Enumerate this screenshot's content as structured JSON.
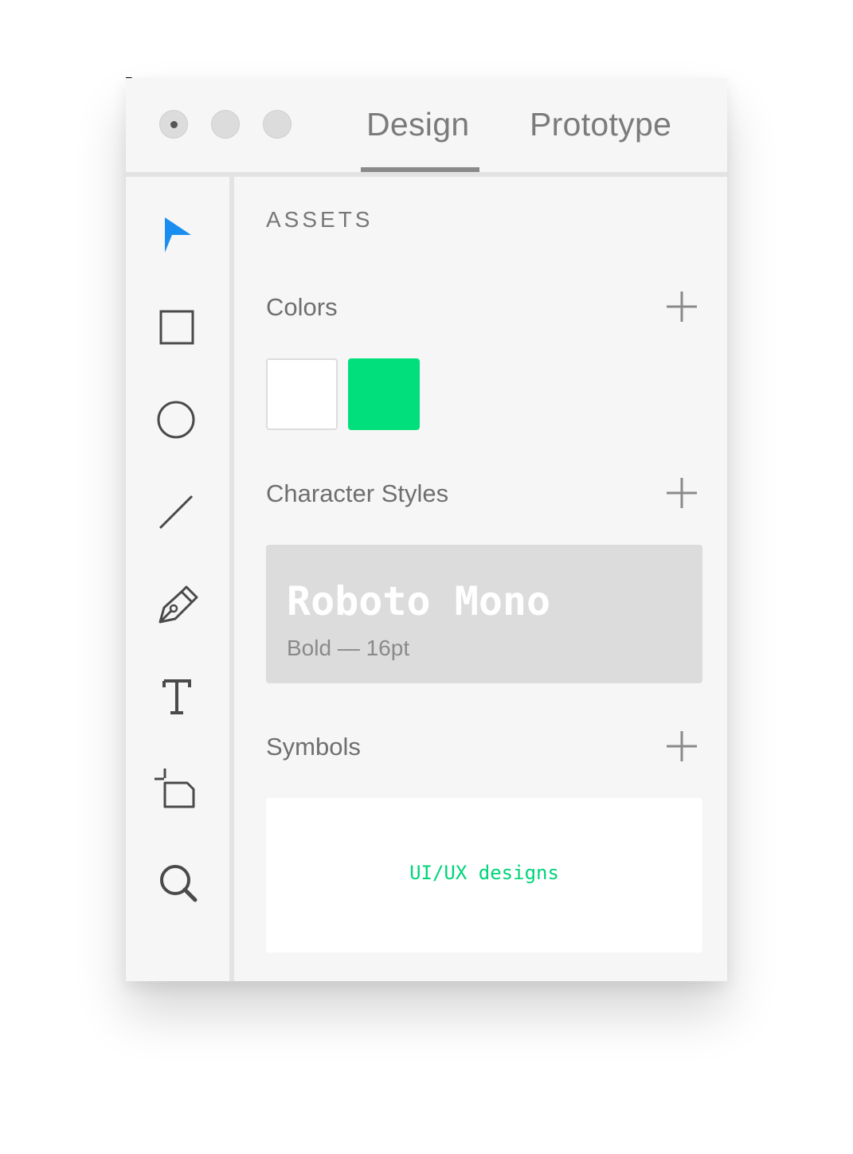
{
  "tabs": [
    {
      "label": "Design",
      "active": true
    },
    {
      "label": "Prototype",
      "active": false
    }
  ],
  "toolbar": {
    "tools": [
      {
        "icon": "select-arrow-icon",
        "active": true,
        "accent": "#1a8ef0"
      },
      {
        "icon": "rectangle-icon"
      },
      {
        "icon": "ellipse-icon"
      },
      {
        "icon": "line-icon"
      },
      {
        "icon": "pen-icon"
      },
      {
        "icon": "text-icon"
      },
      {
        "icon": "artboard-icon"
      },
      {
        "icon": "zoom-icon"
      }
    ]
  },
  "assets": {
    "heading": "ASSETS",
    "colors": {
      "title": "Colors",
      "swatches": [
        "#ffffff",
        "#00df7b"
      ]
    },
    "character_styles": {
      "title": "Character Styles",
      "items": [
        {
          "name": "Roboto Mono",
          "meta": "Bold — 16pt"
        }
      ]
    },
    "symbols": {
      "title": "Symbols",
      "items": [
        {
          "label": "UI/UX designs",
          "color": "#00d47a"
        }
      ]
    }
  }
}
